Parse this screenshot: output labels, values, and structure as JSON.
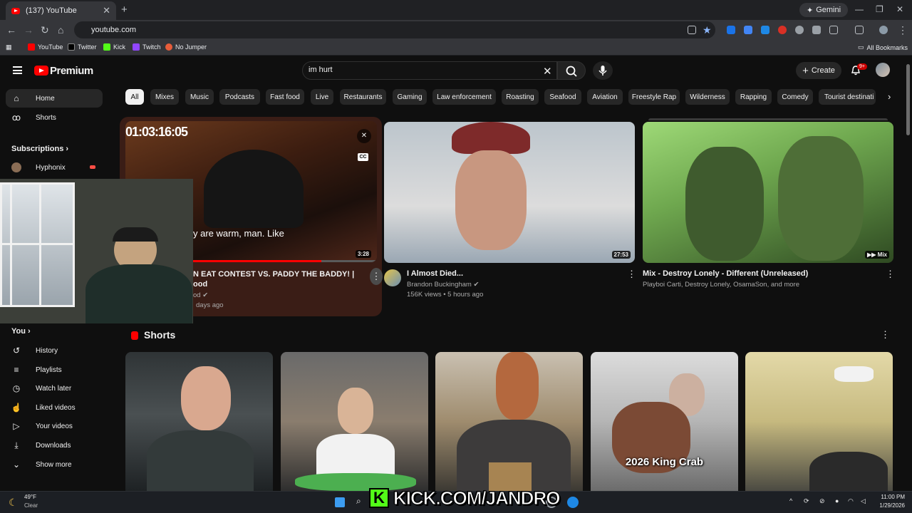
{
  "browser": {
    "tab_title": "(137) YouTube",
    "url": "youtube.com",
    "gemini_label": "Gemini",
    "bookmarks": [
      "YouTube",
      "Twitter",
      "Kick",
      "Twitch",
      "No Jumper"
    ],
    "all_bookmarks": "All Bookmarks"
  },
  "header": {
    "brand": "Premium",
    "search_query": "im hurt",
    "create_label": "Create",
    "notification_count": "9+"
  },
  "sidebar": {
    "home": "Home",
    "shorts": "Shorts",
    "subscriptions": "Subscriptions",
    "sub_items": [
      "Hyphonix"
    ],
    "you": "You",
    "you_items": [
      "History",
      "Playlists",
      "Watch later",
      "Liked videos",
      "Your videos",
      "Downloads",
      "Show more"
    ]
  },
  "chips": [
    "All",
    "Mixes",
    "Music",
    "Podcasts",
    "Fast food",
    "Live",
    "Restaurants",
    "Gaming",
    "Law enforcement",
    "Roasting",
    "Seafood",
    "Aviation",
    "Freestyle Rap",
    "Wilderness",
    "Rapping",
    "Comedy",
    "Tourist destinati"
  ],
  "videos": [
    {
      "overlay_timer": "01:03:16:05",
      "caption": "y are warm, man. Like",
      "duration": "3:28",
      "title_line1": "N EAT CONTEST VS. PADDY THE BADDY! |",
      "title_line2": "ood",
      "channel": "od",
      "meta": "days ago",
      "cc": "CC"
    },
    {
      "title": "I Almost Died...",
      "channel": "Brandon Buckingham",
      "meta": "156K views • 5 hours ago",
      "duration": "27:53"
    },
    {
      "title": "Mix - Destroy Lonely - Different (Unreleased)",
      "channel": "Playboi Carti, Destroy Lonely, OsamaSon, and more",
      "duration": "Mix"
    }
  ],
  "shorts": {
    "title": "Shorts",
    "items": [
      {
        "caption": ""
      },
      {
        "caption": ""
      },
      {
        "caption": ""
      },
      {
        "caption": "2026 King Crab"
      },
      {
        "caption": ""
      }
    ]
  },
  "overlay": {
    "kick_text": "KICK.COM/JANDRO",
    "kick_letter": "K"
  },
  "taskbar": {
    "weather_temp": "49°F",
    "weather_desc": "Clear",
    "time": "11:00 PM",
    "date": "1/29/2026"
  }
}
